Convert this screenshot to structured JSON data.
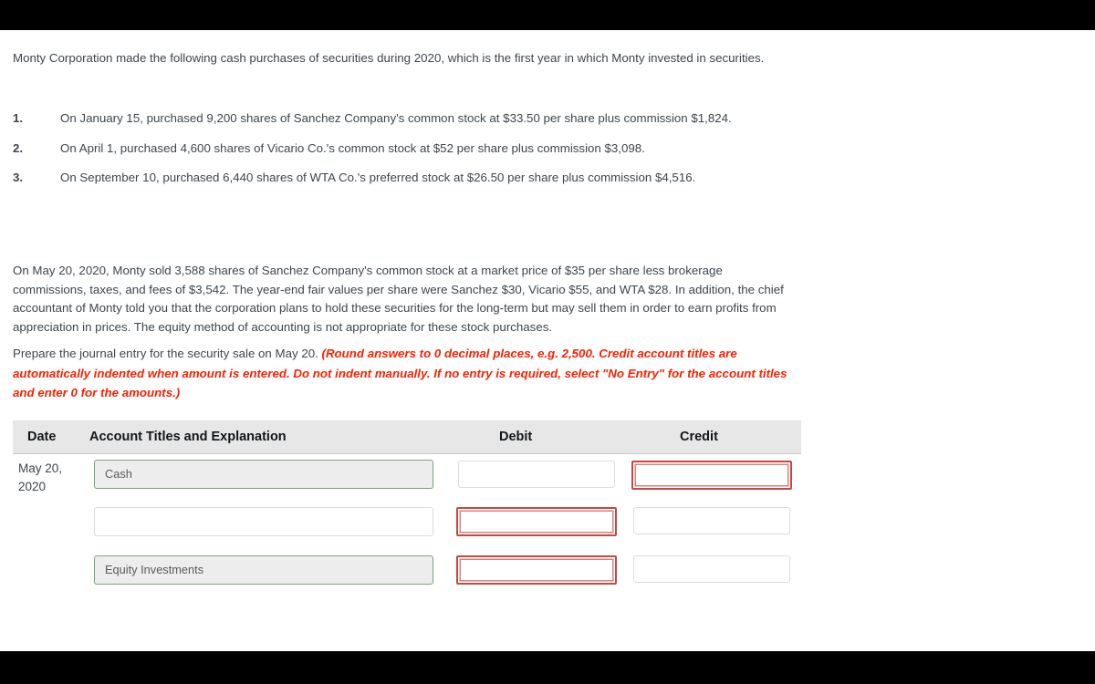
{
  "intro": {
    "paragraph": "Monty Corporation made the following cash purchases of securities during 2020, which is the first year in which Monty invested in securities."
  },
  "purchases": [
    {
      "num": "1.",
      "text": "On January 15, purchased 9,200 shares of Sanchez Company's common stock at $33.50 per share plus commission $1,824."
    },
    {
      "num": "2.",
      "text": "On April 1, purchased 4,600 shares of Vicario Co.'s common stock at $52 per share plus commission $3,098."
    },
    {
      "num": "3.",
      "text": "On September 10, purchased 6,440 shares of WTA Co.'s preferred stock at $26.50 per share plus commission $4,516."
    }
  ],
  "details": {
    "paragraph": "On May 20, 2020, Monty sold 3,588 shares of Sanchez Company's common stock at a market price of $35 per share less brokerage commissions, taxes, and fees of $3,542. The year-end fair values per share were Sanchez $30, Vicario $55, and WTA $28. In addition, the chief accountant of Monty told you that the corporation plans to hold these securities for the long-term but may sell them in order to earn profits from appreciation in prices. The equity method of accounting is not appropriate for these stock purchases."
  },
  "prompt": {
    "lead": "Prepare the journal entry for the security sale on May 20. ",
    "red": "(Round answers to 0 decimal places, e.g. 2,500. Credit account titles are automatically indented when amount is entered. Do not indent manually. If no entry is required, select \"No Entry\" for the account titles and enter 0 for the amounts.)"
  },
  "table": {
    "headers": {
      "date": "Date",
      "account": "Account Titles and Explanation",
      "debit": "Debit",
      "credit": "Credit"
    },
    "rows": [
      {
        "date": "May 20, 2020",
        "account_value": "Cash",
        "account_filled": true,
        "debit_value": "",
        "credit_value": "",
        "debit_error": false,
        "credit_error": true
      },
      {
        "date": "",
        "account_value": "",
        "account_filled": false,
        "debit_value": "",
        "credit_value": "",
        "debit_error": true,
        "credit_error": false
      },
      {
        "date": "",
        "account_value": "Equity Investments",
        "account_filled": true,
        "debit_value": "",
        "credit_value": "",
        "debit_error": true,
        "credit_error": false
      }
    ]
  },
  "colors": {
    "text": "#3c4650",
    "red": "#fc2000",
    "error_border": "#c24a42",
    "filled_border": "#76a678",
    "header_bg": "#e7e7e7"
  }
}
